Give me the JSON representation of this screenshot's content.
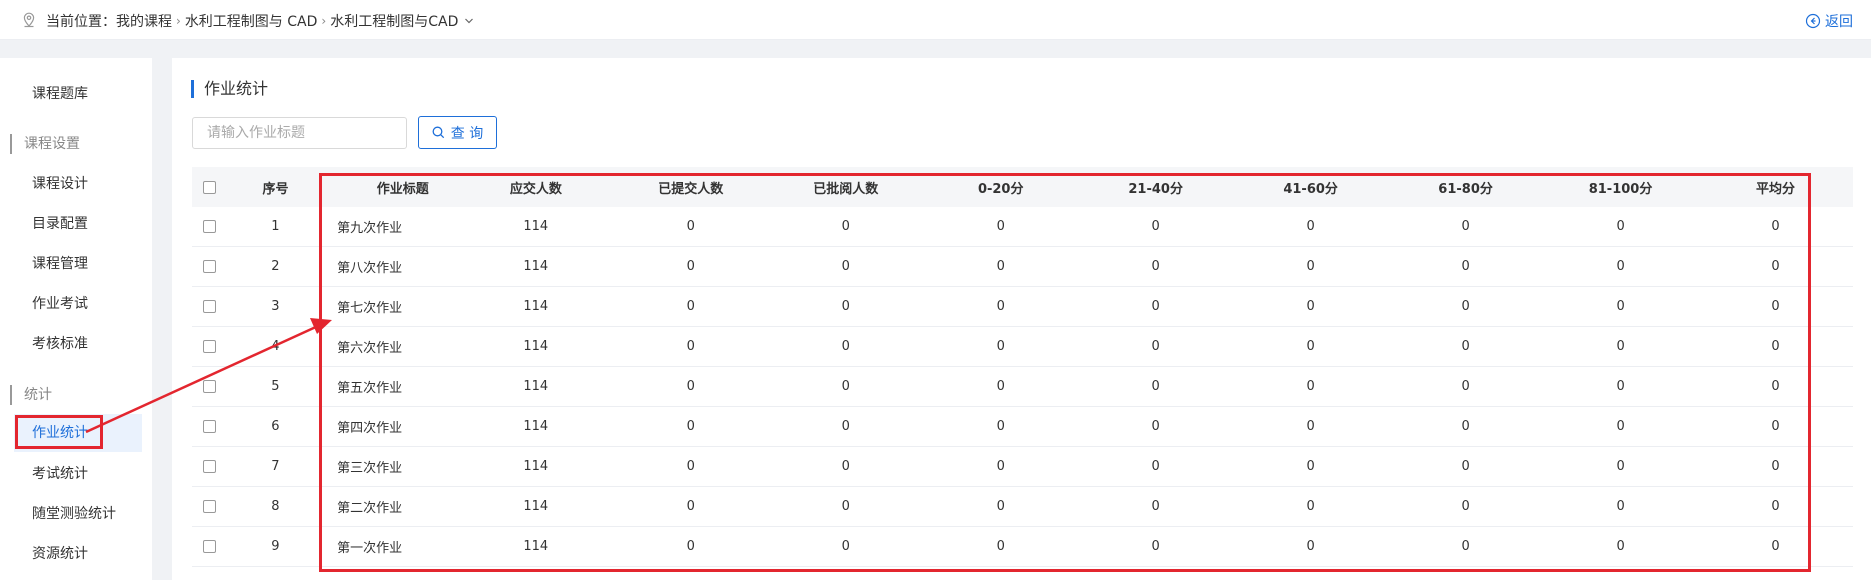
{
  "breadcrumb": {
    "label": "当前位置：",
    "items": [
      "我的课程",
      "水利工程制图与 CAD",
      "水利工程制图与CAD"
    ]
  },
  "header": {
    "back_label": "返回"
  },
  "sidebar": {
    "items": [
      {
        "label": "课程题库",
        "type": "item"
      },
      {
        "label": "课程设置",
        "type": "group"
      },
      {
        "label": "课程设计",
        "type": "item"
      },
      {
        "label": "目录配置",
        "type": "item"
      },
      {
        "label": "课程管理",
        "type": "item"
      },
      {
        "label": "作业考试",
        "type": "item"
      },
      {
        "label": "考核标准",
        "type": "item"
      },
      {
        "label": "统计",
        "type": "group"
      },
      {
        "label": "作业统计",
        "type": "item",
        "active": true
      },
      {
        "label": "考试统计",
        "type": "item"
      },
      {
        "label": "随堂测验统计",
        "type": "item"
      },
      {
        "label": "资源统计",
        "type": "item"
      }
    ]
  },
  "main": {
    "section_title": "作业统计",
    "search": {
      "placeholder": "请输入作业标题",
      "value": ""
    },
    "query_label": "查 询",
    "table": {
      "headers": [
        "序号",
        "作业标题",
        "应交人数",
        "已提交人数",
        "已批阅人数",
        "0-20分",
        "21-40分",
        "41-60分",
        "61-80分",
        "81-100分",
        "平均分"
      ],
      "rows": [
        [
          "1",
          "第九次作业",
          "114",
          "0",
          "0",
          "0",
          "0",
          "0",
          "0",
          "0",
          "0"
        ],
        [
          "2",
          "第八次作业",
          "114",
          "0",
          "0",
          "0",
          "0",
          "0",
          "0",
          "0",
          "0"
        ],
        [
          "3",
          "第七次作业",
          "114",
          "0",
          "0",
          "0",
          "0",
          "0",
          "0",
          "0",
          "0"
        ],
        [
          "4",
          "第六次作业",
          "114",
          "0",
          "0",
          "0",
          "0",
          "0",
          "0",
          "0",
          "0"
        ],
        [
          "5",
          "第五次作业",
          "114",
          "0",
          "0",
          "0",
          "0",
          "0",
          "0",
          "0",
          "0"
        ],
        [
          "6",
          "第四次作业",
          "114",
          "0",
          "0",
          "0",
          "0",
          "0",
          "0",
          "0",
          "0"
        ],
        [
          "7",
          "第三次作业",
          "114",
          "0",
          "0",
          "0",
          "0",
          "0",
          "0",
          "0",
          "0"
        ],
        [
          "8",
          "第二次作业",
          "114",
          "0",
          "0",
          "0",
          "0",
          "0",
          "0",
          "0",
          "0"
        ],
        [
          "9",
          "第一次作业",
          "114",
          "0",
          "0",
          "0",
          "0",
          "0",
          "0",
          "0",
          "0"
        ]
      ]
    }
  },
  "colors": {
    "accent": "#1e6fd9",
    "annotation": "#e3262f"
  },
  "icons": {
    "location": "location-pin-icon",
    "back": "circle-arrow-left-icon",
    "search": "search-icon",
    "dropdown": "chevron-down-icon"
  }
}
